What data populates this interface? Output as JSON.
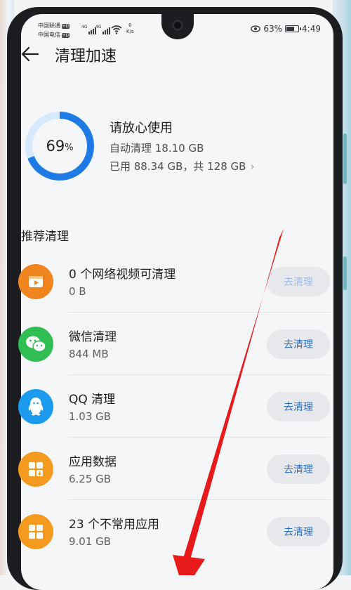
{
  "status_bar": {
    "carrier_1": "中国联通",
    "carrier_2": "中国电信",
    "hd_tag": "HD",
    "network_type": "4G",
    "net_speed_value": "0",
    "net_speed_unit": "K/s",
    "battery_percent": "63%",
    "time": "4:49"
  },
  "header": {
    "title": "清理加速"
  },
  "storage": {
    "used_percent": 69,
    "percent_number": "69",
    "percent_sign": "%",
    "status": "请放心使用",
    "auto_clean": "自动清理 18.10 GB",
    "usage": "已用 88.34 GB，共 128 GB",
    "ring_color": "#1e7be6",
    "ring_track_color": "#d6e8fb"
  },
  "section_title": "推荐清理",
  "items": [
    {
      "title": "0 个网络视频可清理",
      "size": "0 B",
      "button": "去清理",
      "icon": "video-icon",
      "color": "#f0851f",
      "enabled": false
    },
    {
      "title": "微信清理",
      "size": "844 MB",
      "button": "去清理",
      "icon": "wechat-icon",
      "color": "#2fbe52",
      "enabled": true
    },
    {
      "title": "QQ 清理",
      "size": "1.03 GB",
      "button": "去清理",
      "icon": "qq-icon",
      "color": "#1c9aee",
      "enabled": true
    },
    {
      "title": "应用数据",
      "size": "6.25 GB",
      "button": "去清理",
      "icon": "app-data-icon",
      "color": "#f39a1f",
      "enabled": true
    },
    {
      "title": "23 个不常用应用",
      "size": "9.01 GB",
      "button": "去清理",
      "icon": "unused-apps-icon",
      "color": "#f39a1f",
      "enabled": true
    }
  ],
  "annotation_arrow_color": "#e8191b"
}
